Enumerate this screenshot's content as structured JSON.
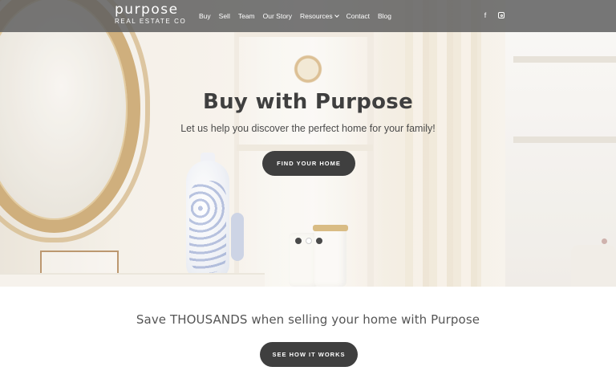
{
  "brand": {
    "name": "purpose",
    "tagline": "REAL ESTATE CO"
  },
  "nav": {
    "items": [
      {
        "label": "Buy"
      },
      {
        "label": "Sell"
      },
      {
        "label": "Team"
      },
      {
        "label": "Our Story"
      },
      {
        "label": "Resources",
        "has_dropdown": true
      },
      {
        "label": "Contact"
      },
      {
        "label": "Blog"
      }
    ],
    "social": [
      {
        "icon": "facebook-icon",
        "glyph": "f"
      },
      {
        "icon": "instagram-icon"
      }
    ]
  },
  "hero": {
    "title": "Buy with Purpose",
    "subtitle": "Let us help you discover the perfect home for your family!",
    "cta_label": "FIND YOUR HOME",
    "slides": 3,
    "active_slide": 2
  },
  "section": {
    "title": "Save THOUSANDS when selling your home with Purpose",
    "cta_label": "SEE HOW IT WORKS"
  },
  "colors": {
    "nav_bg": "#5f5f5f",
    "button_bg": "#3f3f3f",
    "text_dark": "#3f3f3f"
  }
}
